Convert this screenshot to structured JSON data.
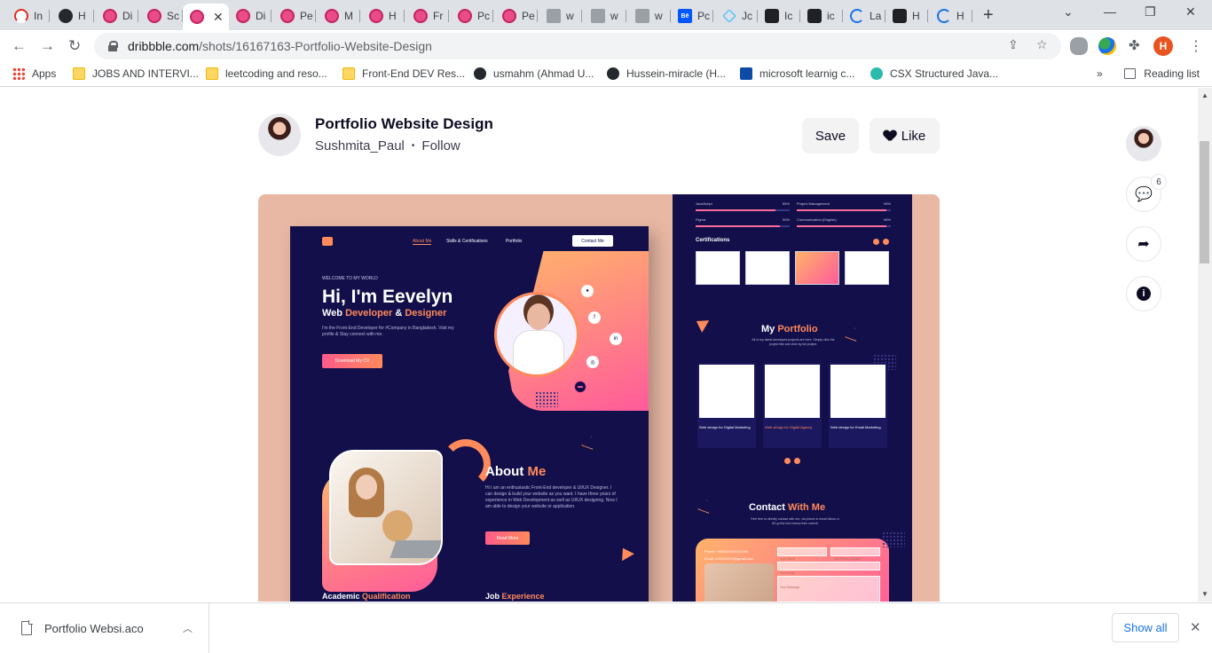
{
  "browser": {
    "tabs": [
      {
        "title": "In",
        "icon": "speed"
      },
      {
        "title": "H",
        "icon": "github"
      },
      {
        "title": "Di",
        "icon": "dribbble"
      },
      {
        "title": "Sc",
        "icon": "dribbble"
      },
      {
        "title": "",
        "icon": "dribbble",
        "active": true
      },
      {
        "title": "Di",
        "icon": "dribbble"
      },
      {
        "title": "Pe",
        "icon": "dribbble"
      },
      {
        "title": "M",
        "icon": "dribbble"
      },
      {
        "title": "H",
        "icon": "dribbble"
      },
      {
        "title": "Fr",
        "icon": "dribbble"
      },
      {
        "title": "Pc",
        "icon": "dribbble"
      },
      {
        "title": "Pe",
        "icon": "dribbble"
      },
      {
        "title": "w",
        "icon": "behance-gray"
      },
      {
        "title": "w",
        "icon": "behance-gray"
      },
      {
        "title": "w",
        "icon": "behance-gray"
      },
      {
        "title": "Pc",
        "icon": "behance"
      },
      {
        "title": "Jc",
        "icon": "diamond"
      },
      {
        "title": "Ic",
        "icon": "dark"
      },
      {
        "title": "ic",
        "icon": "dark"
      },
      {
        "title": "La",
        "icon": "ring"
      },
      {
        "title": "H",
        "icon": "dark"
      },
      {
        "title": "H",
        "icon": "ring"
      }
    ],
    "new_tab": "+",
    "url_host": "dribbble.com",
    "url_path": "/shots/16167163-Portfolio-Website-Design",
    "profile_initial": "H",
    "bookmarks": [
      {
        "label": "Apps",
        "icon": "apps"
      },
      {
        "label": "JOBS AND INTERVI...",
        "icon": "folder"
      },
      {
        "label": "leetcoding and reso...",
        "icon": "folder"
      },
      {
        "label": "Front-End DEV Res...",
        "icon": "folder"
      },
      {
        "label": "usmahm (Ahmad U...",
        "icon": "gh"
      },
      {
        "label": "Hussein-miracle (H...",
        "icon": "gh"
      },
      {
        "label": "microsoft learnig c...",
        "icon": "ms"
      },
      {
        "label": "CSX Structured Java...",
        "icon": "csx"
      }
    ],
    "overflow": "»",
    "reading_list": "Reading list"
  },
  "shot": {
    "title": "Portfolio Website Design",
    "author": "Sushmita_Paul",
    "separator": "•",
    "follow": "Follow",
    "save": "Save",
    "like": "Like",
    "comment_count": "6"
  },
  "mockup": {
    "nav": [
      "About Me",
      "Skills & Certifications",
      "Portfolio"
    ],
    "contact_btn": "Contact Me",
    "welcome": "WELCOME TO MY WORLD",
    "hero": "Hi, I'm Eevelyn",
    "role_a": "Web ",
    "role_b": "Developer",
    "role_c": " & ",
    "role_d": "Designer",
    "intro": "I'm the Front-End Developer for #Company in Bangladesh. Visit my profile & Stay connect with me.",
    "download_cv": "Download My CV",
    "about_a": "About ",
    "about_b": "Me",
    "about_text": "Hi I am an enthusiastic Front-End developer & UI/UX Designer. I can design & build your website as you want. I have three years of experience in Web Development as well as UI/UX designing. Now I am able to design your website or application.",
    "read_more": "Read More",
    "academic_a": "Academic ",
    "academic_b": "Qualification",
    "job_a": "Job ",
    "job_b": "Experience",
    "skills": [
      {
        "name": "JavaScript",
        "pct": "85%"
      },
      {
        "name": "Project Management",
        "pct": "95%"
      },
      {
        "name": "Figma",
        "pct": "90%"
      },
      {
        "name": "Communication (English)",
        "pct": "95%"
      }
    ],
    "certifications": "Certifications",
    "portfolio_a": "My ",
    "portfolio_b": "Portfolio",
    "portfolio_text": "All of my latest developed projects are here. Simply click the project title and visit my full project.",
    "projects": [
      "Web design for Digital Marketing",
      "Web design for Digital Agency",
      "Web design for Email Marketing"
    ],
    "contact_a": "Contact ",
    "contact_b": "With Me",
    "contact_text": "Feel free to directly contact with me, via phone or email below or fill up the form below then submit",
    "phone": "Phone: +8801XXXXXXXXX",
    "email": "Email: eXXXXXXX@gmail.com",
    "form_fields": [
      "Your Name",
      "Your Phone Number",
      "Your Email",
      "Your Message"
    ]
  },
  "download": {
    "filename": "Portfolio Websi.aco",
    "show_all": "Show all"
  }
}
